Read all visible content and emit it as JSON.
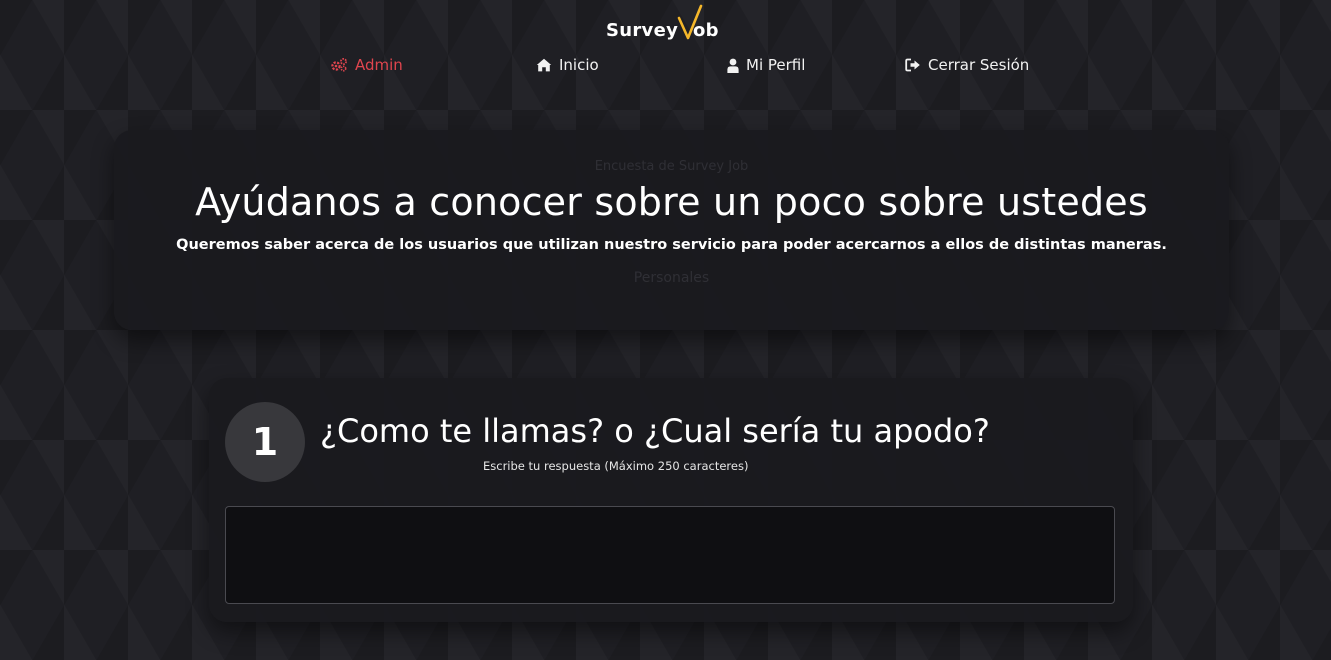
{
  "brand": {
    "logo_left": "Survey",
    "logo_right": "ob",
    "check_color": "#f5b72a"
  },
  "nav": {
    "items": [
      {
        "label": "Admin",
        "icon": "gears-icon",
        "active": true
      },
      {
        "label": "Inicio",
        "icon": "home-icon",
        "active": false
      },
      {
        "label": "Mi Perfil",
        "icon": "user-icon",
        "active": false
      },
      {
        "label": "Cerrar Sesión",
        "icon": "sign-out-icon",
        "active": false
      }
    ],
    "active_color": "#e0454e"
  },
  "hero": {
    "eyebrow": "Encuesta de Survey Job",
    "title": "Ayúdanos a conocer sobre un poco sobre ustedes",
    "subtitle": "Queremos saber acerca de los usuarios que utilizan nuestro servicio para poder acercarnos a ellos de distintas maneras.",
    "category": "Personales"
  },
  "question": {
    "number": "1",
    "title": "¿Como te llamas? o ¿Cual sería tu apodo?",
    "hint": "Escribe tu respuesta (Máximo 250 caracteres)",
    "answer_value": "",
    "answer_placeholder": ""
  }
}
